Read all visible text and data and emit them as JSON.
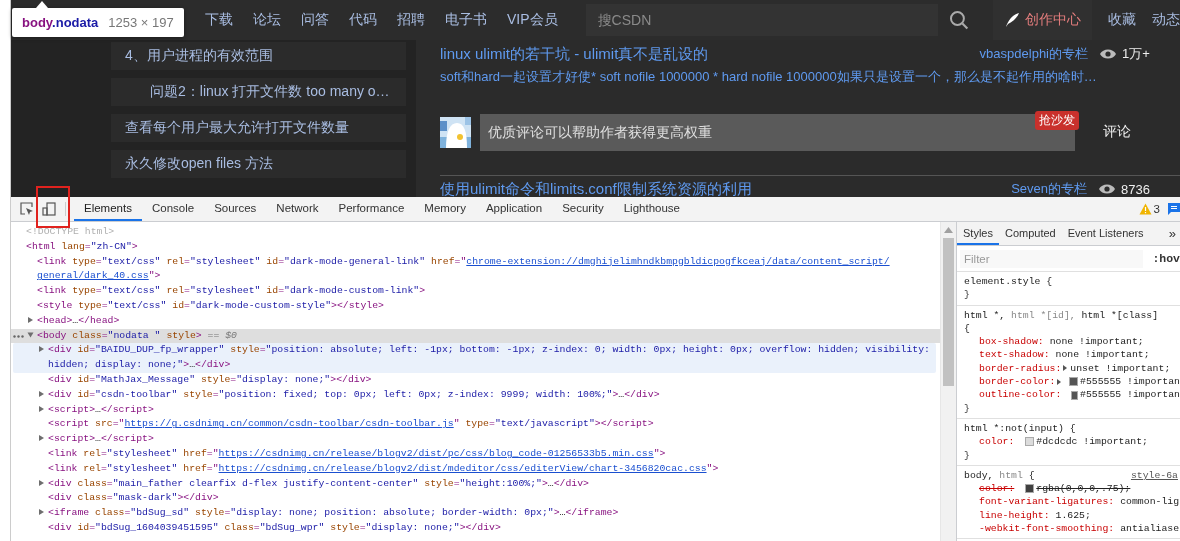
{
  "tooltip": {
    "tag": "body",
    "class_name": ".nodata",
    "size": "1253 × 197"
  },
  "nav": {
    "items": [
      "下载",
      "论坛",
      "问答",
      "代码",
      "招聘",
      "电子书",
      "VIP会员"
    ],
    "search": {
      "placeholder": "搜CSDN"
    },
    "create": "创作中心",
    "links": [
      "收藏",
      "动态"
    ]
  },
  "toc": [
    {
      "text": "4、用户进程的有效范围",
      "children": [
        {
          "text": "问题2：linux 打开文件数 too many o…"
        }
      ]
    },
    {
      "text": "查看每个用户最大允许打开文件数量"
    },
    {
      "text": "永久修改open files 方法"
    }
  ],
  "articles": [
    {
      "title": "linux ulimit的若干坑 - ulimit真不是乱设的",
      "source": "vbaspdelphi的专栏",
      "views": "1万+",
      "desc": "soft和hard一起设置才好使* soft nofile 1000000 * hard nofile 1000000如果只是设置一个，那么是不起作用的啥时…"
    },
    {
      "title": "使用ulimit命令和limits.conf限制系统资源的利用",
      "source": "Seven的专栏",
      "views": "8736"
    }
  ],
  "comment": {
    "placeholder": "优质评论可以帮助作者获得更高权重",
    "badge": "抢沙发",
    "button": "评论"
  },
  "devtools": {
    "tabs": [
      {
        "label": "Elements",
        "selected": true
      },
      {
        "label": "Console",
        "selected": false
      },
      {
        "label": "Sources",
        "selected": false
      },
      {
        "label": "Network",
        "selected": false
      },
      {
        "label": "Performance",
        "selected": false
      },
      {
        "label": "Memory",
        "selected": false
      },
      {
        "label": "Application",
        "selected": false
      },
      {
        "label": "Security",
        "selected": false
      },
      {
        "label": "Lighthouse",
        "selected": false
      }
    ],
    "warnings": "3",
    "dom": [
      {
        "selected": false,
        "highlighted": false,
        "tokens": [
          {
            "kind": "doctype",
            "text": "<!DOCTYPE html>"
          }
        ]
      },
      {
        "selected": false,
        "highlighted": false,
        "tokens": [
          {
            "kind": "tag",
            "text": "<html"
          },
          {
            "kind": "attr",
            "text": " lang"
          },
          {
            "kind": "tag",
            "text": "="
          },
          {
            "kind": "val",
            "text": "\"zh-CN\""
          },
          {
            "kind": "tag",
            "text": ">"
          }
        ],
        "children": [
          {
            "selected": false,
            "highlighted": false,
            "tokens": [
              {
                "kind": "tag",
                "text": "<link"
              },
              {
                "kind": "attr",
                "text": " type"
              },
              {
                "kind": "tag",
                "text": "="
              },
              {
                "kind": "val",
                "text": "\"text/css\""
              },
              {
                "kind": "attr",
                "text": " rel"
              },
              {
                "kind": "tag",
                "text": "="
              },
              {
                "kind": "val",
                "text": "\"stylesheet\""
              },
              {
                "kind": "attr",
                "text": " id"
              },
              {
                "kind": "tag",
                "text": "="
              },
              {
                "kind": "val",
                "text": "\"dark-mode-general-link\""
              },
              {
                "kind": "attr",
                "text": " href"
              },
              {
                "kind": "tag",
                "text": "=\""
              },
              {
                "kind": "link",
                "text": "chrome-extension://dmghijelimhndkbmpgbldicpogfkceaj/data/content_script/"
              },
              {
                "kind": "br"
              },
              {
                "kind": "link",
                "text": "general/dark_40.css"
              },
              {
                "kind": "tag",
                "text": "\">"
              }
            ]
          },
          {
            "selected": false,
            "highlighted": false,
            "tokens": [
              {
                "kind": "tag",
                "text": "<link"
              },
              {
                "kind": "attr",
                "text": " type"
              },
              {
                "kind": "tag",
                "text": "="
              },
              {
                "kind": "val",
                "text": "\"text/css\""
              },
              {
                "kind": "attr",
                "text": " rel"
              },
              {
                "kind": "tag",
                "text": "="
              },
              {
                "kind": "val",
                "text": "\"stylesheet\""
              },
              {
                "kind": "attr",
                "text": " id"
              },
              {
                "kind": "tag",
                "text": "="
              },
              {
                "kind": "val",
                "text": "\"dark-mode-custom-link\""
              },
              {
                "kind": "tag",
                "text": ">"
              }
            ]
          },
          {
            "selected": false,
            "highlighted": false,
            "tokens": [
              {
                "kind": "tag",
                "text": "<style"
              },
              {
                "kind": "attr",
                "text": " type"
              },
              {
                "kind": "tag",
                "text": "="
              },
              {
                "kind": "val",
                "text": "\"text/css\""
              },
              {
                "kind": "attr",
                "text": " id"
              },
              {
                "kind": "tag",
                "text": "="
              },
              {
                "kind": "val",
                "text": "\"dark-mode-custom-style\""
              },
              {
                "kind": "tag",
                "text": "></style>"
              }
            ]
          },
          {
            "selected": false,
            "highlighted": false,
            "toggle": true,
            "expanded": false,
            "tokens": [
              {
                "kind": "tag",
                "text": "<head>"
              },
              {
                "kind": "text",
                "text": "…"
              },
              {
                "kind": "tag",
                "text": "</head>"
              }
            ]
          },
          {
            "selected": true,
            "highlighted": false,
            "toggle": true,
            "expanded": true,
            "tokens": [
              {
                "kind": "tag",
                "text": "<body"
              },
              {
                "kind": "attr",
                "text": " class"
              },
              {
                "kind": "tag",
                "text": "="
              },
              {
                "kind": "val",
                "text": "\"nodata \""
              },
              {
                "kind": "attr",
                "text": " style"
              },
              {
                "kind": "tag",
                "text": ">"
              },
              {
                "kind": "hint",
                "text": " == $0"
              }
            ],
            "children": [
              {
                "selected": false,
                "highlighted": true,
                "toggle": true,
                "expanded": false,
                "tokens": [
                  {
                    "kind": "tag",
                    "text": "<div"
                  },
                  {
                    "kind": "attr",
                    "text": " id"
                  },
                  {
                    "kind": "tag",
                    "text": "="
                  },
                  {
                    "kind": "val",
                    "text": "\"BAIDU_DUP_fp_wrapper\""
                  },
                  {
                    "kind": "attr",
                    "text": " style"
                  },
                  {
                    "kind": "tag",
                    "text": "="
                  },
                  {
                    "kind": "val",
                    "text": "\"position: absolute; left: -1px; bottom: -1px; z-index: 0; width: 0px; height: 0px; overflow: hidden; visibility:"
                  },
                  {
                    "kind": "br"
                  },
                  {
                    "kind": "val",
                    "text": "hidden; display: none;\""
                  },
                  {
                    "kind": "tag",
                    "text": ">"
                  },
                  {
                    "kind": "text",
                    "text": "…"
                  },
                  {
                    "kind": "tag",
                    "text": "</div>"
                  }
                ]
              },
              {
                "selected": false,
                "highlighted": false,
                "tokens": [
                  {
                    "kind": "tag",
                    "text": "<div"
                  },
                  {
                    "kind": "attr",
                    "text": " id"
                  },
                  {
                    "kind": "tag",
                    "text": "="
                  },
                  {
                    "kind": "val",
                    "text": "\"MathJax_Message\""
                  },
                  {
                    "kind": "attr",
                    "text": " style"
                  },
                  {
                    "kind": "tag",
                    "text": "="
                  },
                  {
                    "kind": "val",
                    "text": "\"display: none;\""
                  },
                  {
                    "kind": "tag",
                    "text": "></div>"
                  }
                ]
              },
              {
                "selected": false,
                "highlighted": false,
                "toggle": true,
                "expanded": false,
                "tokens": [
                  {
                    "kind": "tag",
                    "text": "<div"
                  },
                  {
                    "kind": "attr",
                    "text": " id"
                  },
                  {
                    "kind": "tag",
                    "text": "="
                  },
                  {
                    "kind": "val",
                    "text": "\"csdn-toolbar\""
                  },
                  {
                    "kind": "attr",
                    "text": " style"
                  },
                  {
                    "kind": "tag",
                    "text": "="
                  },
                  {
                    "kind": "val",
                    "text": "\"position: fixed; top: 0px; left: 0px; z-index: 9999; width: 100%;\""
                  },
                  {
                    "kind": "tag",
                    "text": ">"
                  },
                  {
                    "kind": "text",
                    "text": "…"
                  },
                  {
                    "kind": "tag",
                    "text": "</div>"
                  }
                ]
              },
              {
                "selected": false,
                "highlighted": false,
                "toggle": true,
                "expanded": false,
                "tokens": [
                  {
                    "kind": "tag",
                    "text": "<script>"
                  },
                  {
                    "kind": "text",
                    "text": "…"
                  },
                  {
                    "kind": "tag",
                    "text": "</script>"
                  }
                ]
              },
              {
                "selected": false,
                "highlighted": false,
                "tokens": [
                  {
                    "kind": "tag",
                    "text": "<script"
                  },
                  {
                    "kind": "attr",
                    "text": " src"
                  },
                  {
                    "kind": "tag",
                    "text": "=\""
                  },
                  {
                    "kind": "link",
                    "text": "https://g.csdnimg.cn/common/csdn-toolbar/csdn-toolbar.js"
                  },
                  {
                    "kind": "tag",
                    "text": "\""
                  },
                  {
                    "kind": "attr",
                    "text": " type"
                  },
                  {
                    "kind": "tag",
                    "text": "="
                  },
                  {
                    "kind": "val",
                    "text": "\"text/javascript\""
                  },
                  {
                    "kind": "tag",
                    "text": "></script>"
                  }
                ]
              },
              {
                "selected": false,
                "highlighted": false,
                "toggle": true,
                "expanded": false,
                "tokens": [
                  {
                    "kind": "tag",
                    "text": "<script>"
                  },
                  {
                    "kind": "text",
                    "text": "…"
                  },
                  {
                    "kind": "tag",
                    "text": "</script>"
                  }
                ]
              },
              {
                "selected": false,
                "highlighted": false,
                "tokens": [
                  {
                    "kind": "tag",
                    "text": "<link"
                  },
                  {
                    "kind": "attr",
                    "text": " rel"
                  },
                  {
                    "kind": "tag",
                    "text": "="
                  },
                  {
                    "kind": "val",
                    "text": "\"stylesheet\""
                  },
                  {
                    "kind": "attr",
                    "text": " href"
                  },
                  {
                    "kind": "tag",
                    "text": "=\""
                  },
                  {
                    "kind": "link",
                    "text": "https://csdnimg.cn/release/blogv2/dist/pc/css/blog_code-01256533b5.min.css"
                  },
                  {
                    "kind": "tag",
                    "text": "\">"
                  }
                ]
              },
              {
                "selected": false,
                "highlighted": false,
                "tokens": [
                  {
                    "kind": "tag",
                    "text": "<link"
                  },
                  {
                    "kind": "attr",
                    "text": " rel"
                  },
                  {
                    "kind": "tag",
                    "text": "="
                  },
                  {
                    "kind": "val",
                    "text": "\"stylesheet\""
                  },
                  {
                    "kind": "attr",
                    "text": " href"
                  },
                  {
                    "kind": "tag",
                    "text": "=\""
                  },
                  {
                    "kind": "link",
                    "text": "https://csdnimg.cn/release/blogv2/dist/mdeditor/css/editerView/chart-3456820cac.css"
                  },
                  {
                    "kind": "tag",
                    "text": "\">"
                  }
                ]
              },
              {
                "selected": false,
                "highlighted": false,
                "toggle": true,
                "expanded": false,
                "tokens": [
                  {
                    "kind": "tag",
                    "text": "<div"
                  },
                  {
                    "kind": "attr",
                    "text": " class"
                  },
                  {
                    "kind": "tag",
                    "text": "="
                  },
                  {
                    "kind": "val",
                    "text": "\"main_father clearfix d-flex justify-content-center\""
                  },
                  {
                    "kind": "attr",
                    "text": " style"
                  },
                  {
                    "kind": "tag",
                    "text": "="
                  },
                  {
                    "kind": "val",
                    "text": "\"height:100%;\""
                  },
                  {
                    "kind": "tag",
                    "text": ">"
                  },
                  {
                    "kind": "text",
                    "text": "…"
                  },
                  {
                    "kind": "tag",
                    "text": "</div>"
                  }
                ]
              },
              {
                "selected": false,
                "highlighted": false,
                "tokens": [
                  {
                    "kind": "tag",
                    "text": "<div"
                  },
                  {
                    "kind": "attr",
                    "text": " class"
                  },
                  {
                    "kind": "tag",
                    "text": "="
                  },
                  {
                    "kind": "val",
                    "text": "\"mask-dark\""
                  },
                  {
                    "kind": "tag",
                    "text": "></div>"
                  }
                ]
              },
              {
                "selected": false,
                "highlighted": false,
                "toggle": true,
                "expanded": false,
                "tokens": [
                  {
                    "kind": "tag",
                    "text": "<iframe"
                  },
                  {
                    "kind": "attr",
                    "text": " class"
                  },
                  {
                    "kind": "tag",
                    "text": "="
                  },
                  {
                    "kind": "val",
                    "text": "\"bdSug_sd\""
                  },
                  {
                    "kind": "attr",
                    "text": " style"
                  },
                  {
                    "kind": "tag",
                    "text": "="
                  },
                  {
                    "kind": "val",
                    "text": "\"display: none; position: absolute; border-width: 0px;\""
                  },
                  {
                    "kind": "tag",
                    "text": ">"
                  },
                  {
                    "kind": "text",
                    "text": "…"
                  },
                  {
                    "kind": "tag",
                    "text": "</iframe>"
                  }
                ]
              },
              {
                "selected": false,
                "highlighted": false,
                "tokens": [
                  {
                    "kind": "tag",
                    "text": "<div"
                  },
                  {
                    "kind": "attr",
                    "text": " id"
                  },
                  {
                    "kind": "tag",
                    "text": "="
                  },
                  {
                    "kind": "val",
                    "text": "\"bdSug_1604039451595\""
                  },
                  {
                    "kind": "attr",
                    "text": " class"
                  },
                  {
                    "kind": "tag",
                    "text": "="
                  },
                  {
                    "kind": "val",
                    "text": "\"bdSug_wpr\""
                  },
                  {
                    "kind": "attr",
                    "text": " style"
                  },
                  {
                    "kind": "tag",
                    "text": "="
                  },
                  {
                    "kind": "val",
                    "text": "\"display: none;\""
                  },
                  {
                    "kind": "tag",
                    "text": "></div>"
                  }
                ]
              }
            ]
          }
        ]
      }
    ],
    "styles": {
      "tabs": [
        {
          "label": "Styles",
          "selected": true
        },
        {
          "label": "Computed",
          "selected": false
        },
        {
          "label": "Event Listeners",
          "selected": false
        }
      ],
      "more": "»",
      "filter": {
        "placeholder": "Filter"
      },
      "hov": ":hov",
      "rules": [
        {
          "selector": [
            {
              "kind": "match",
              "text": "element.style {"
            }
          ],
          "close": "}"
        },
        {
          "selector": [
            {
              "kind": "match",
              "text": "html *,"
            },
            {
              "kind": "nomatch",
              "text": " html *[id],"
            },
            {
              "kind": "match",
              "text": " html *[class]"
            },
            {
              "kind": "br"
            },
            {
              "kind": "match",
              "text": "{"
            }
          ],
          "decls": [
            {
              "prop": "box-shadow:",
              "value": "none !important;",
              "struck": false
            },
            {
              "prop": "text-shadow:",
              "value": "none !important;",
              "struck": false
            },
            {
              "prop": "border-radius:",
              "expander": true,
              "value": "unset !important;",
              "struck": false
            },
            {
              "prop": "border-color:",
              "expander": true,
              "color": "#555555",
              "value": "#555555 !importan",
              "struck": false
            },
            {
              "prop": "outline-color:",
              "color": "#555555",
              "value": "#555555 !importan",
              "struck": false
            }
          ],
          "close": "}"
        },
        {
          "selector": [
            {
              "kind": "match",
              "text": "html *:not(input) {"
            }
          ],
          "decls": [
            {
              "prop": "color:",
              "color": "#dcdcdc",
              "value": "#dcdcdc !important;",
              "struck": false
            }
          ],
          "close": "}"
        },
        {
          "selector": [
            {
              "kind": "match",
              "text": "body,"
            },
            {
              "kind": "nomatch",
              "text": " html"
            },
            {
              "kind": "match",
              "text": " {"
            }
          ],
          "source": "style-6a",
          "decls": [
            {
              "prop": "color:",
              "color": "#404040",
              "value": "rgba(0,0,0,.75);",
              "struck": true
            },
            {
              "prop": "font-variant-ligatures:",
              "value": "common-lig",
              "struck": false
            },
            {
              "prop": "line-height:",
              "value": "1.625;",
              "struck": false
            },
            {
              "prop": "-webkit-font-smoothing:",
              "value": "antialiase",
              "struck": false
            }
          ]
        }
      ]
    }
  }
}
